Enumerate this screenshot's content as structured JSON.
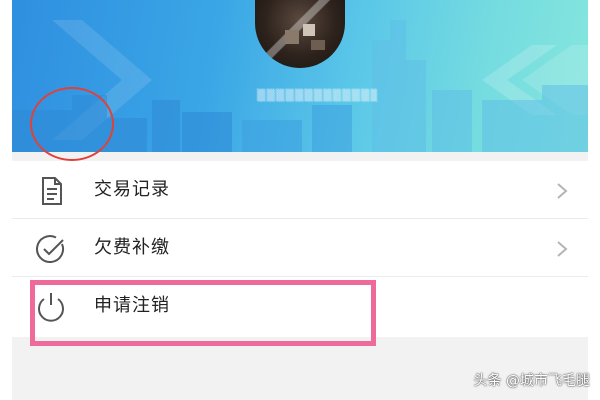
{
  "header": {
    "avatar_icon": "user-avatar-pixelated",
    "username": "▒▒▒▒▒▒▒▒▒▒▒▒▒用户名"
  },
  "menu": {
    "items": [
      {
        "label": "交易记录",
        "icon": "document-icon",
        "has_chevron": true
      },
      {
        "label": "欠费补缴",
        "icon": "check-circle-icon",
        "has_chevron": true
      },
      {
        "label": "申请注销",
        "icon": "power-icon",
        "has_chevron": false
      }
    ]
  },
  "annotations": {
    "circle_color": "#e0413a",
    "highlight_color": "#ee6a9a"
  },
  "watermark": "头条 @城市飞毛腿",
  "colors": {
    "banner_start": "#2f8fe0",
    "banner_end": "#86e6dd",
    "text": "#222222",
    "icon": "#555555"
  }
}
